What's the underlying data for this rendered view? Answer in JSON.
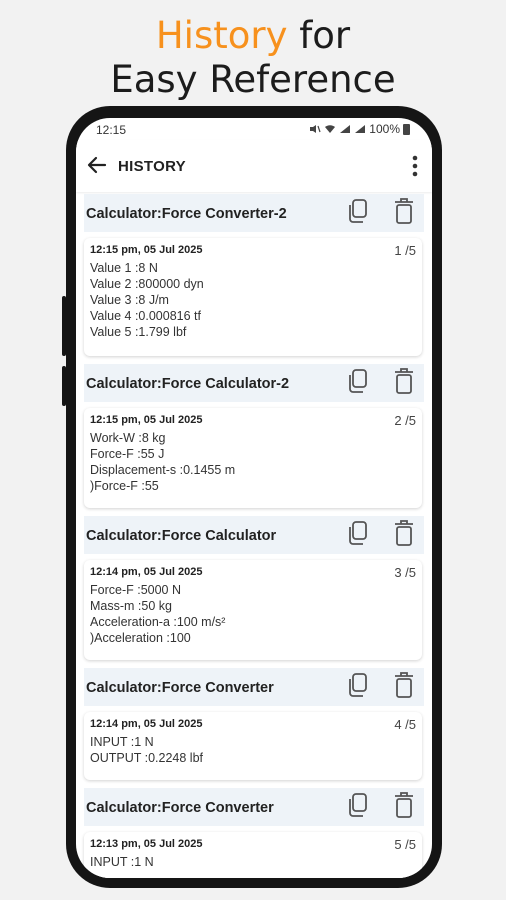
{
  "promo": {
    "headline_accent": "History",
    "headline_rest": " for",
    "headline_line2": "Easy Reference"
  },
  "status_bar": {
    "time": "12:15",
    "battery": "100%"
  },
  "app_bar": {
    "title": "HISTORY"
  },
  "entries": [
    {
      "title": "Calculator:Force Converter-2",
      "timestamp": "12:15 pm, 05 Jul 2025",
      "page": "1 /5",
      "lines": [
        "Value 1 :8 N",
        "Value 2 :800000 dyn",
        "Value 3 :8 J/m",
        "Value 4 :0.000816 tf",
        "Value 5 :1.799 lbf"
      ]
    },
    {
      "title": "Calculator:Force Calculator-2",
      "timestamp": "12:15 pm, 05 Jul 2025",
      "page": "2 /5",
      "lines": [
        "Work-W :8 kg",
        "Force-F :55 J",
        "Displacement-s :0.1455 m",
        ")Force-F :55"
      ]
    },
    {
      "title": "Calculator:Force Calculator",
      "timestamp": "12:14 pm, 05 Jul 2025",
      "page": "3 /5",
      "lines": [
        "Force-F :5000 N",
        "Mass-m :50 kg",
        "Acceleration-a :100 m/s²",
        ")Acceleration :100"
      ]
    },
    {
      "title": "Calculator:Force Converter",
      "timestamp": "12:14 pm, 05 Jul 2025",
      "page": "4 /5",
      "lines": [
        "INPUT :1 N",
        "OUTPUT :0.2248 lbf"
      ]
    },
    {
      "title": "Calculator:Force Converter",
      "timestamp": "12:13 pm, 05 Jul 2025",
      "page": "5 /5",
      "lines": [
        "INPUT :1 N"
      ]
    }
  ]
}
